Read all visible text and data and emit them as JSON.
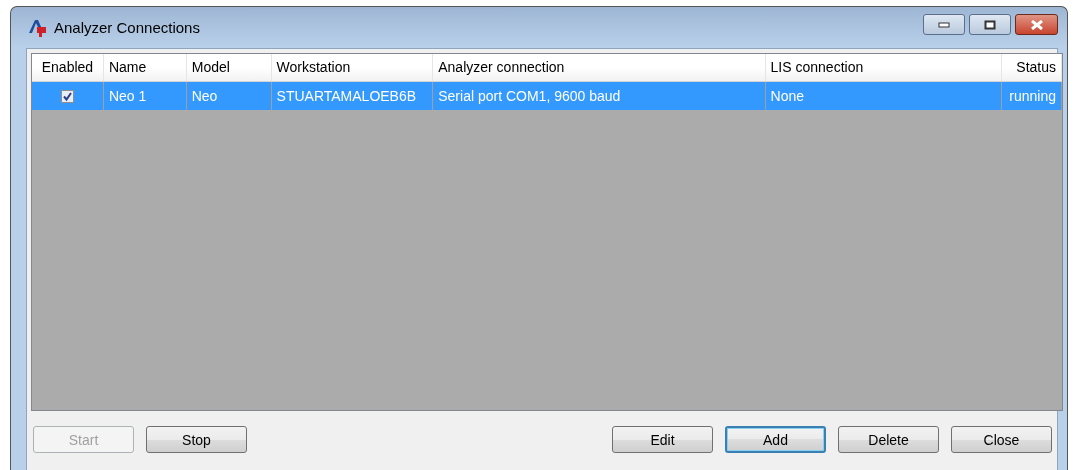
{
  "window": {
    "title": "Analyzer Connections"
  },
  "table": {
    "columns": [
      "Enabled",
      "Name",
      "Model",
      "Workstation",
      "Analyzer connection",
      "LIS connection",
      "Status"
    ],
    "rows": [
      {
        "selected": true,
        "enabled": true,
        "name": "Neo 1",
        "model": "Neo",
        "workstation": "STUARTAMALOEB6B",
        "analyzer_connection": "Serial port COM1, 9600 baud",
        "lis_connection": "None",
        "status": "running"
      }
    ]
  },
  "buttons_left": [
    {
      "label": "Start",
      "disabled": true,
      "default": false
    },
    {
      "label": "Stop",
      "disabled": false,
      "default": false
    }
  ],
  "buttons_right": [
    {
      "label": "Edit",
      "disabled": false,
      "default": false
    },
    {
      "label": "Add",
      "disabled": false,
      "default": true
    },
    {
      "label": "Delete",
      "disabled": false,
      "default": false
    },
    {
      "label": "Close",
      "disabled": false,
      "default": false
    }
  ]
}
